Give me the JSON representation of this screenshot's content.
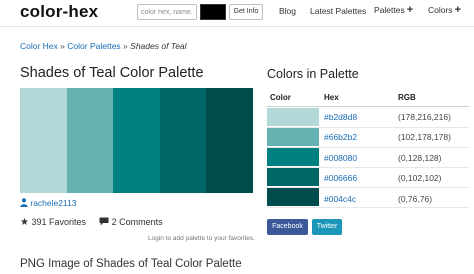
{
  "header": {
    "brand": "color-hex",
    "search_placeholder": "color hex, name...",
    "get_info_label": "Get Info",
    "nav": [
      {
        "label": "Blog"
      },
      {
        "label": "Latest Palettes"
      },
      {
        "label": "Palettes",
        "suffix": "+"
      },
      {
        "label": "Colors",
        "suffix": "+"
      }
    ]
  },
  "breadcrumb": {
    "home": "Color Hex",
    "sep1": "»",
    "section": "Color Palettes",
    "sep2": "»",
    "current": "Shades of Teal"
  },
  "page": {
    "title": "Shades of Teal Color Palette",
    "author": "rachele2113",
    "favorites": "391 Favorites",
    "comments": "2 Comments",
    "login_note": "Login to add palette to your favorites.",
    "png_title": "PNG Image of Shades of Teal Color Palette"
  },
  "palette": {
    "colors": [
      "#b2d8d8",
      "#66b2b2",
      "#008080",
      "#006666",
      "#004c4c"
    ]
  },
  "colors_table": {
    "title": "Colors in Palette",
    "headers": {
      "color": "Color",
      "hex": "Hex",
      "rgb": "RGB"
    },
    "rows": [
      {
        "hex": "#b2d8d8",
        "rgb": "(178,216,216)"
      },
      {
        "hex": "#66b2b2",
        "rgb": "(102,178,178)"
      },
      {
        "hex": "#008080",
        "rgb": "(0,128,128)"
      },
      {
        "hex": "#006666",
        "rgb": "(0,102,102)"
      },
      {
        "hex": "#004c4c",
        "rgb": "(0,76,76)"
      }
    ]
  },
  "share": {
    "facebook_label": "Facebook",
    "twitter_label": "Twitter",
    "facebook_color": "#3b5998",
    "twitter_color": "#1b95b8"
  },
  "colors": {
    "link": "#1a6cb5",
    "swatch_black": "#000000"
  }
}
